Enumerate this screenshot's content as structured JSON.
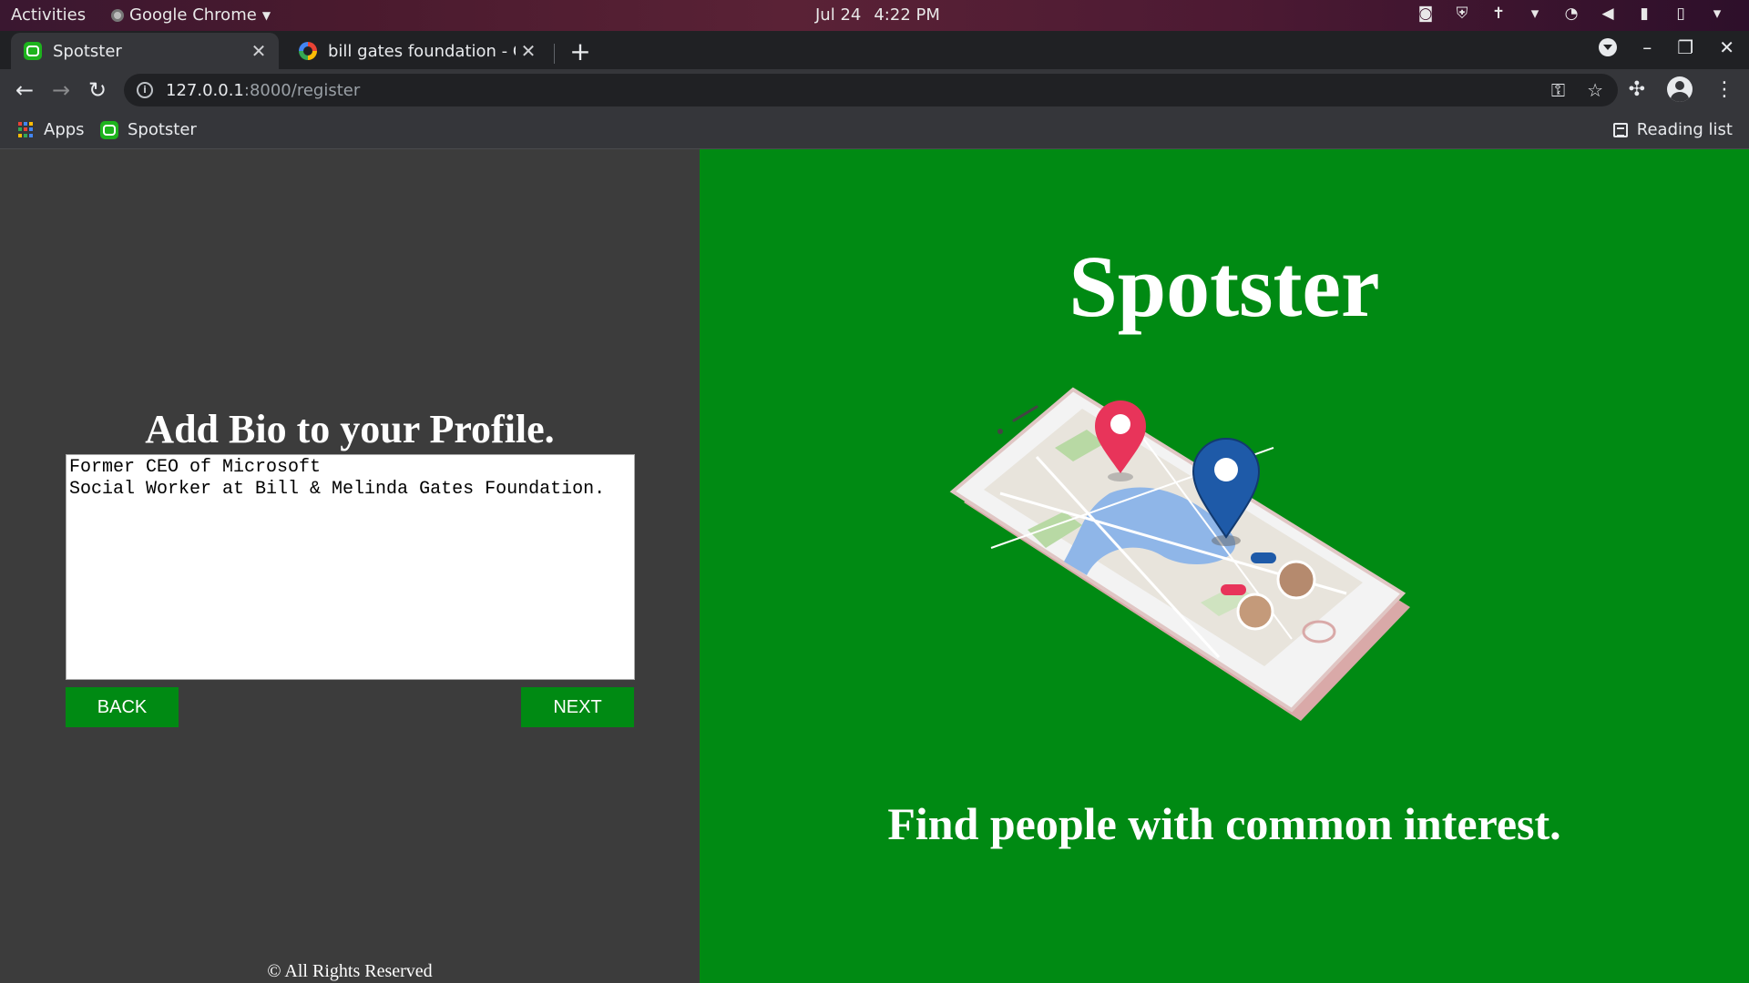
{
  "system_bar": {
    "activities": "Activities",
    "app_name": "Google Chrome",
    "date": "Jul 24",
    "time": "4:22 PM"
  },
  "tabs": [
    {
      "title": "Spotster",
      "icon": "spotster-favicon",
      "active": true
    },
    {
      "title": "bill gates foundation - Google Search",
      "icon": "google-favicon",
      "active": false
    }
  ],
  "address_bar": {
    "host": "127.0.0.1",
    "path": ":8000/register"
  },
  "bookmarks": {
    "apps_label": "Apps",
    "spotster_label": "Spotster",
    "reading_list_label": "Reading list"
  },
  "form": {
    "title": "Add Bio to your Profile.",
    "bio_value": "Former CEO of Microsoft\nSocial Worker at Bill & Melinda Gates Foundation.",
    "back_label": "BACK",
    "next_label": "NEXT",
    "footer": "© All Rights Reserved"
  },
  "hero": {
    "brand": "Spotster",
    "tagline": "Find people with common interest."
  },
  "colors": {
    "brand_green": "#008a13",
    "left_panel": "#3c3c3c"
  }
}
